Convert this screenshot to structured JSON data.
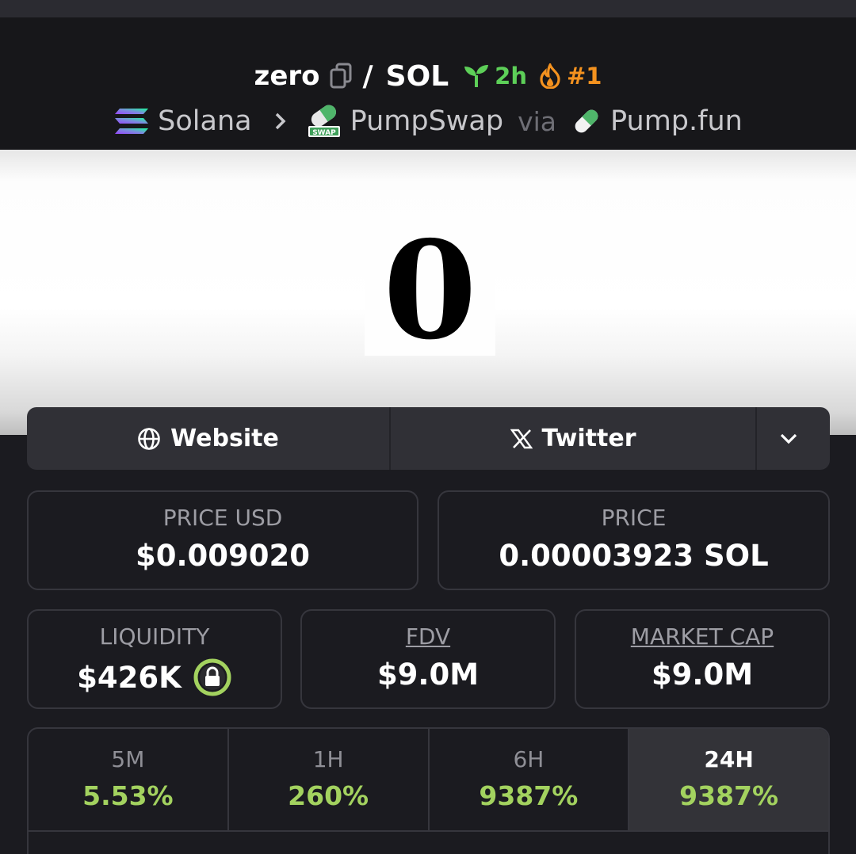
{
  "header": {
    "base_token": "zero",
    "separator": "/",
    "quote_token": "SOL",
    "age": "2h",
    "rank": "#1",
    "chain": "Solana",
    "dex": "PumpSwap",
    "via_label": "via",
    "launchpad": "Pump.fun",
    "dex_badge_text": "SWAP"
  },
  "banner": {
    "logo_text": "0"
  },
  "links": {
    "website_label": "Website",
    "twitter_label": "Twitter"
  },
  "stats": {
    "price_usd_label": "PRICE USD",
    "price_usd_value": "$0.009020",
    "price_label": "PRICE",
    "price_value": "0.00003923 SOL",
    "liquidity_label": "LIQUIDITY",
    "liquidity_value": "$426K",
    "fdv_label": "FDV",
    "fdv_value": "$9.0M",
    "mcap_label": "MARKET CAP",
    "mcap_value": "$9.0M"
  },
  "timeframes": [
    {
      "label": "5M",
      "change": "5.53%"
    },
    {
      "label": "1H",
      "change": "260%"
    },
    {
      "label": "6H",
      "change": "9387%"
    },
    {
      "label": "24H",
      "change": "9387%"
    }
  ],
  "active_timeframe": "24H",
  "colors": {
    "positive": "#a3d25f",
    "age": "#5dcf58",
    "rank": "#f4921f",
    "liquidity_lock": "#a3d25f"
  }
}
